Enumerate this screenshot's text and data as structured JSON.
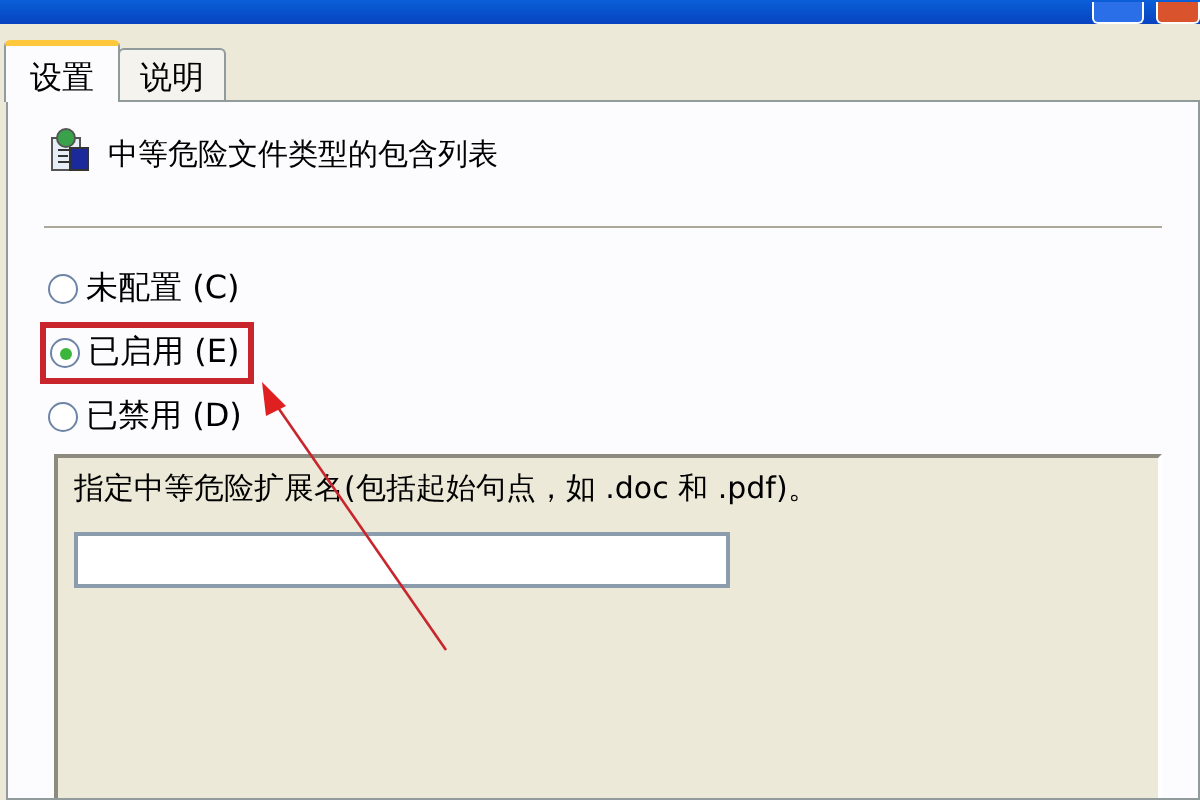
{
  "tabs": [
    {
      "label": "设置",
      "selected": true
    },
    {
      "label": "说明",
      "selected": false
    }
  ],
  "setting": {
    "title": "中等危险文件类型的包含列表"
  },
  "options": [
    {
      "label": "未配置 (C)",
      "selected": false,
      "highlighted": false
    },
    {
      "label": "已启用 (E)",
      "selected": true,
      "highlighted": true
    },
    {
      "label": "已禁用 (D)",
      "selected": false,
      "highlighted": false
    }
  ],
  "options_box": {
    "prompt": "指定中等危险扩展名(包括起始句点，如 .doc 和 .pdf)。"
  }
}
